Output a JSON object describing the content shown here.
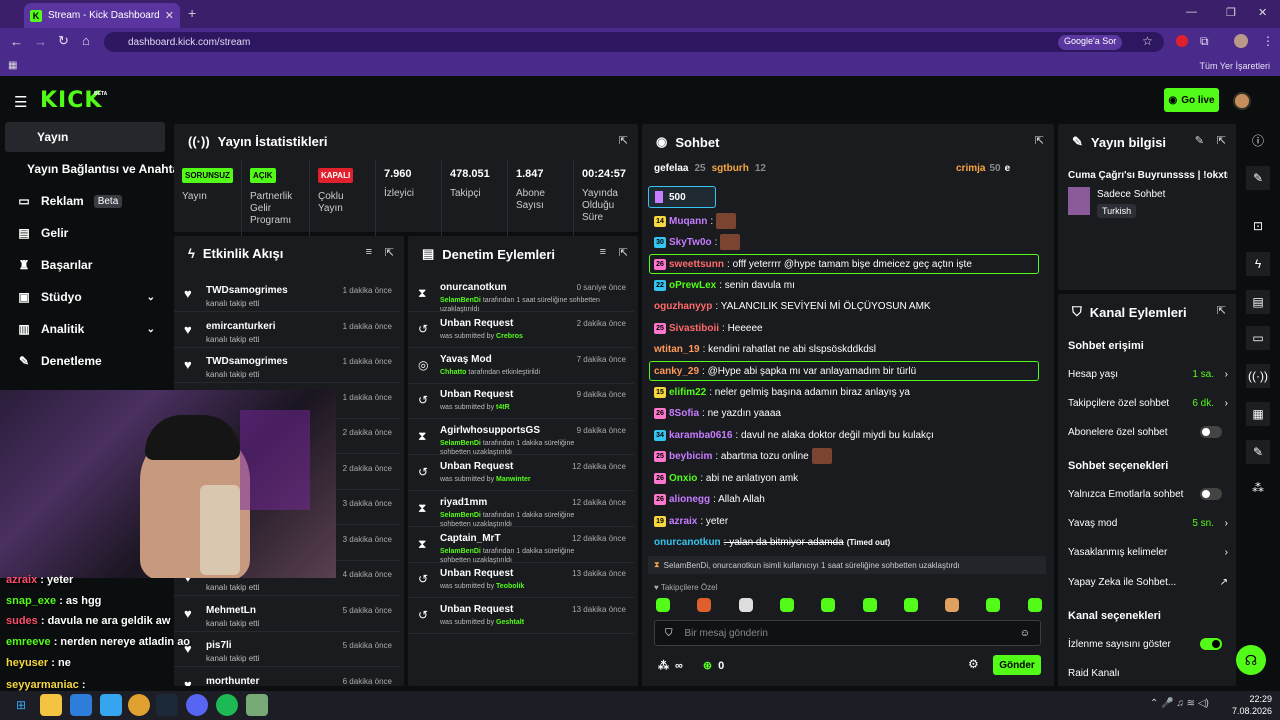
{
  "browser": {
    "tab_title": "Stream - Kick Dashboard",
    "url": "dashboard.kick.com/stream",
    "google_label": "Google'a Sor",
    "bookmarks_label": "Tüm Yer İşaretleri"
  },
  "header": {
    "logo": "KICK",
    "beta": "BETA",
    "go_live": "Go live"
  },
  "sidebar": {
    "items": [
      {
        "label": "Yayın"
      },
      {
        "label": "Yayın Bağlantısı ve Anahtarı"
      },
      {
        "label": "Reklam",
        "badge": "Beta"
      },
      {
        "label": "Gelir"
      },
      {
        "label": "Başarılar"
      },
      {
        "label": "Stüdyo"
      },
      {
        "label": "Analitik"
      },
      {
        "label": "Denetleme"
      }
    ]
  },
  "stats": {
    "title": "Yayın İstatistikleri",
    "items": [
      {
        "value": "SORUNSUZ",
        "label": "Yayın"
      },
      {
        "value": "AÇIK",
        "label": "Partnerlik Gelir Programı"
      },
      {
        "value": "KAPALI",
        "label": "Çoklu Yayın"
      },
      {
        "value": "7.960",
        "label": "İzleyici"
      },
      {
        "value": "478.051",
        "label": "Takipçi"
      },
      {
        "value": "1.847",
        "label": "Abone Sayısı"
      },
      {
        "value": "00:24:57",
        "label": "Yayında Olduğu Süre"
      }
    ]
  },
  "activity": {
    "title": "Etkinlik Akışı",
    "items": [
      {
        "name": "TWDsamogrimes",
        "sub": "kanalı takip etti",
        "time": "1 dakika önce"
      },
      {
        "name": "emircanturkeri",
        "sub": "kanalı takip etti",
        "time": "1 dakika önce"
      },
      {
        "name": "TWDsamogrimes",
        "sub": "kanalı takip etti",
        "time": "1 dakika önce"
      },
      {
        "name": "",
        "sub": "",
        "time": "1 dakika önce"
      },
      {
        "name": "",
        "sub": "",
        "time": "2 dakika önce"
      },
      {
        "name": "",
        "sub": "",
        "time": "2 dakika önce"
      },
      {
        "name": "",
        "sub": "",
        "time": "3 dakika önce"
      },
      {
        "name": "",
        "sub": "",
        "time": "3 dakika önce"
      },
      {
        "name": "",
        "sub": "kanalı takip etti",
        "time": "4 dakika önce"
      },
      {
        "name": "MehmetLn",
        "sub": "kanalı takip etti",
        "time": "5 dakika önce"
      },
      {
        "name": "pis7li",
        "sub": "kanalı takip etti",
        "time": "5 dakika önce"
      },
      {
        "name": "morthunter",
        "sub": "",
        "time": "6 dakika önce"
      }
    ]
  },
  "moderation": {
    "title": "Denetim Eylemleri",
    "items": [
      {
        "icon": "hourglass",
        "name": "onurcanotkun",
        "by": "SelamBenDi",
        "sub": "tarafından 1 saat süreliğine sohbetten uzaklaştırıldı",
        "time": "0 saniye önce"
      },
      {
        "icon": "undo",
        "name": "Unban Request",
        "by": "Crebros",
        "pre": "was submitted by",
        "time": "2 dakika önce"
      },
      {
        "icon": "snail",
        "name": "Yavaş Mod",
        "by": "Chhatto",
        "sub": "tarafından etkinleştirildi",
        "time": "7 dakika önce"
      },
      {
        "icon": "undo",
        "name": "Unban Request",
        "by": "t4tR",
        "pre": "was submitted by",
        "time": "9 dakika önce"
      },
      {
        "icon": "hourglass",
        "name": "AgirlwhosupportsGS",
        "by": "SelamBenDi",
        "sub": "tarafından 1 dakika süreliğine sohbetten uzaklaştırıldı",
        "time": "9 dakika önce"
      },
      {
        "icon": "undo",
        "name": "Unban Request",
        "by": "Manwinter",
        "pre": "was submitted by",
        "time": "12 dakika önce"
      },
      {
        "icon": "hourglass",
        "name": "riyad1mm",
        "by": "SelamBenDi",
        "sub": "tarafından 1 dakika süreliğine sohbetten uzaklaştırıldı",
        "time": "12 dakika önce"
      },
      {
        "icon": "hourglass",
        "name": "Captain_MrT",
        "by": "SelamBenDi",
        "sub": "tarafından 1 dakika süreliğine sohbetten uzaklaştırıldı",
        "time": "12 dakika önce"
      },
      {
        "icon": "undo",
        "name": "Unban Request",
        "by": "Teobolik",
        "pre": "was submitted by",
        "time": "13 dakika önce"
      },
      {
        "icon": "undo",
        "name": "Unban Request",
        "by": "Geshtalt",
        "pre": "was submitted by",
        "time": "13 dakika önce"
      }
    ]
  },
  "chat": {
    "title": "Sohbet",
    "top": [
      {
        "name": "gefelaa",
        "n": "25"
      },
      {
        "name": "sgtburh",
        "n": "12"
      },
      {
        "name": "crimja",
        "n": "50"
      },
      {
        "name": "e",
        "n": ""
      }
    ],
    "pinned": "500",
    "messages": [
      {
        "badge": "14",
        "bc": "#f5d742",
        "user": "Muqann",
        "uc": "#c77dff",
        "text": ":",
        "emote": true,
        "hl": false
      },
      {
        "badge": "30",
        "bc": "#36c5f0",
        "user": "SkyTw0o",
        "uc": "#c77dff",
        "text": ":",
        "emote": true,
        "hl": false
      },
      {
        "badge": "26",
        "bc": "#ff77cc",
        "user": "sweettsunn",
        "uc": "#ff6b6b",
        "text": ": offf yeterrrr @hype tamam bişe dmeicez geç açtın işte",
        "hl": true
      },
      {
        "badge": "22",
        "bc": "#36c5f0",
        "user": "oPrewLex",
        "uc": "#53fc18",
        "text": ": senin davula mı",
        "hl": false
      },
      {
        "badge": "",
        "bc": "",
        "user": "oguzhanyyp",
        "uc": "#ff6b6b",
        "text": ": YALANCILIK SEVİYENİ Mİ ÖLÇÜYOSUN AMK",
        "hl": false
      },
      {
        "badge": "25",
        "bc": "#ff77cc",
        "user": "Sivastiboii",
        "uc": "#ff6b6b",
        "text": ": Heeeee",
        "hl": false
      },
      {
        "badge": "",
        "bc": "",
        "user": "wtitan_19",
        "uc": "#ff9a5a",
        "text": ": kendini rahatlat ne abi slspsöskddkdsl",
        "hl": false
      },
      {
        "badge": "",
        "bc": "",
        "user": "canky_29",
        "uc": "#ff9a5a",
        "text": ": @Hype abi şapka mı var anlayamadım bir türlü",
        "hl": true
      },
      {
        "badge": "15",
        "bc": "#f5d742",
        "user": "elifim22",
        "uc": "#53fc18",
        "text": ": neler gelmiş başına adamın biraz anlayış ya",
        "hl": false
      },
      {
        "badge": "26",
        "bc": "#ff77cc",
        "user": "8Sofia",
        "uc": "#c77dff",
        "text": ": ne yazdın yaaaa",
        "hl": false
      },
      {
        "badge": "34",
        "bc": "#36c5f0",
        "user": "karamba0616",
        "uc": "#c77dff",
        "text": ": davul ne alaka doktor değil miydi bu kulakçı",
        "hl": false
      },
      {
        "badge": "25",
        "bc": "#ff77cc",
        "user": "beybicim",
        "uc": "#c77dff",
        "text": ": abartma tozu online",
        "emote": true,
        "hl": false
      },
      {
        "badge": "26",
        "bc": "#ff77cc",
        "user": "Onxio",
        "uc": "#53fc18",
        "text": ": abi ne anlatıyon amk",
        "hl": false
      },
      {
        "badge": "26",
        "bc": "#ff77cc",
        "user": "alionegg",
        "uc": "#c77dff",
        "text": ": Allah Allah",
        "hl": false
      },
      {
        "badge": "19",
        "bc": "#f5d742",
        "user": "azraix",
        "uc": "#c77dff",
        "text": ": yeter",
        "hl": false
      },
      {
        "badge": "",
        "bc": "",
        "user": "onurcanotkun",
        "uc": "#36c5f0",
        "text": ": yalan da bitmiyor adamda",
        "note": "(Timed out)",
        "hl": false
      }
    ],
    "system": "SelamBenDi, onurcanotkun isimli kullanıcıyı 1 saat süreliğine sohbetten uzaklaştırdı",
    "followers_only": "Takipçilere Özel",
    "input_placeholder": "Bir mesaj gönderin",
    "points": "∞",
    "coins": "0",
    "send": "Gönder"
  },
  "stream_info": {
    "title": "Yayın bilgisi",
    "stream_title": "Cuma Çağrı'sı Buyrunssss | !okxtr",
    "category": "Sadece Sohbet",
    "tag": "Turkish"
  },
  "channel_actions": {
    "title": "Kanal Eylemleri",
    "chat_access": "Sohbet erişimi",
    "account_age": {
      "label": "Hesap yaşı",
      "value": "1 sa."
    },
    "followers_chat": {
      "label": "Takipçilere özel sohbet",
      "value": "6 dk."
    },
    "subs_chat": {
      "label": "Abonelere özel sohbet"
    },
    "chat_options": "Sohbet seçenekleri",
    "emote_only": {
      "label": "Yalnızca Emotlarla sohbet"
    },
    "slow_mode": {
      "label": "Yavaş mod",
      "value": "5 sn."
    },
    "banned_words": {
      "label": "Yasaklanmış kelimeler"
    },
    "ai_chat": {
      "label": "Yapay Zeka ile Sohbet..."
    },
    "channel_options": "Kanal seçenekleri",
    "show_views": {
      "label": "İzlenme sayısını göster"
    },
    "raid": {
      "label": "Raid Kanalı"
    }
  },
  "overlay_chat": [
    {
      "user": "azraix",
      "uc": "#ff4d6d",
      "text": " : yeter"
    },
    {
      "user": "snap_exe",
      "uc": "#53fc18",
      "text": " : as hgg"
    },
    {
      "user": "sudes",
      "uc": "#ff4d6d",
      "text": " : davula ne ara geldik aw"
    },
    {
      "user": "emreeve",
      "uc": "#53fc18",
      "text": " : nerden nereye atladin ao"
    },
    {
      "user": "heyuser",
      "uc": "#f5d742",
      "text": " : ne"
    },
    {
      "user": "seyyarmaniac",
      "uc": "#f5d742",
      "text": " :"
    }
  ],
  "taskbar": {
    "time": "22:29",
    "date": "7.08.2026"
  },
  "colors": {
    "accent": "#53fc18",
    "panel": "#191b1f",
    "bg": "#0b0e0f"
  }
}
